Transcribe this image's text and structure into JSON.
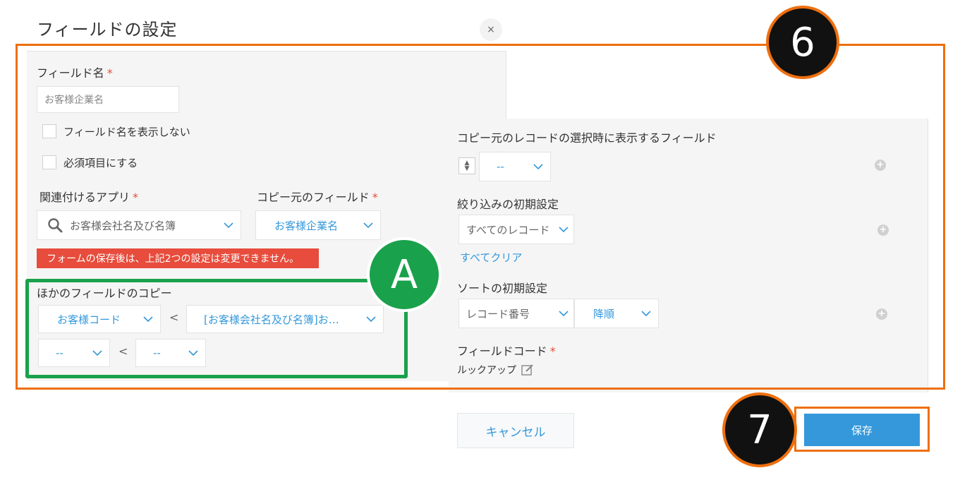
{
  "dialog": {
    "title": "フィールドの設定",
    "close": "×"
  },
  "left": {
    "field_name_label": "フィールド名",
    "required_mark": "*",
    "field_name_value": "お客様企業名",
    "hide_name_label": "フィールド名を表示しない",
    "required_label": "必須項目にする",
    "related_app_label": "関連付けるアプリ",
    "related_app_value": "お客様会社名及び名簿",
    "copy_source_label": "コピー元のフィールド",
    "copy_source_value": "お客様企業名",
    "error_message": "フォームの保存後は、上記2つの設定は変更できません。",
    "other_copy_label": "ほかのフィールドのコピー",
    "copy_rows": [
      {
        "dest": "お客様コード",
        "src": "[お客様会社名及び名簿]お…",
        "sep": "<"
      },
      {
        "dest": "--",
        "src": "--",
        "sep": "<"
      }
    ]
  },
  "right": {
    "display_fields_label": "コピー元のレコードの選択時に表示するフィールド",
    "display_field_value": "--",
    "filter_label": "絞り込みの初期設定",
    "filter_value": "すべてのレコード",
    "clear_all": "すべてクリア",
    "sort_label": "ソートの初期設定",
    "sort_field_value": "レコード番号",
    "sort_order_value": "降順",
    "field_code_label": "フィールドコード",
    "field_code_value": "ルックアップ",
    "plus": "+"
  },
  "buttons": {
    "cancel": "キャンセル",
    "save": "保存"
  },
  "annotations": {
    "six": "6",
    "seven": "7",
    "a": "A"
  },
  "colors": {
    "accent": "#3498db",
    "error": "#e74c3c",
    "orange": "#ee6f0e",
    "green": "#1aa14b"
  }
}
